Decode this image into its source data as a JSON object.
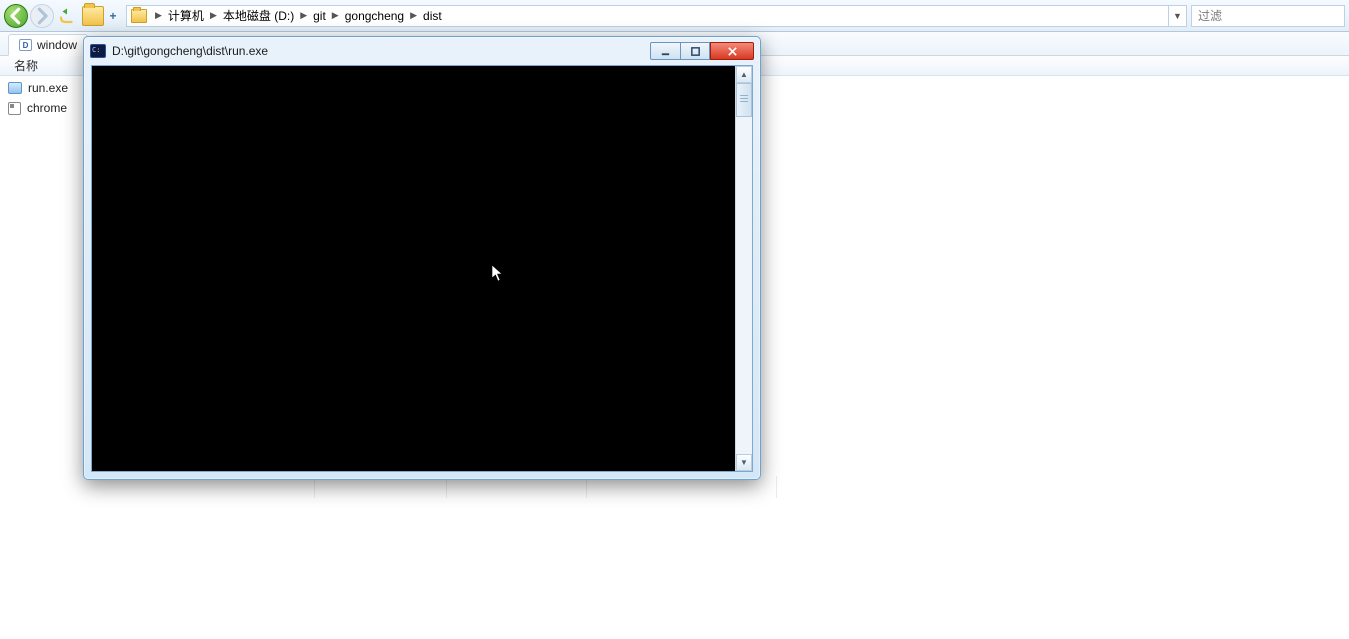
{
  "explorer": {
    "breadcrumbs": {
      "b0": "计算机",
      "b1": "本地磁盘 (D:)",
      "b2": "git",
      "b3": "gongcheng",
      "b4": "dist"
    },
    "filter_placeholder": "过滤",
    "tab_label": "window",
    "columns": {
      "name": "名称"
    },
    "files": {
      "f0": {
        "name": "run.exe"
      },
      "f1": {
        "name": "chrome"
      }
    }
  },
  "console": {
    "title": "D:\\git\\gongcheng\\dist\\run.exe"
  }
}
